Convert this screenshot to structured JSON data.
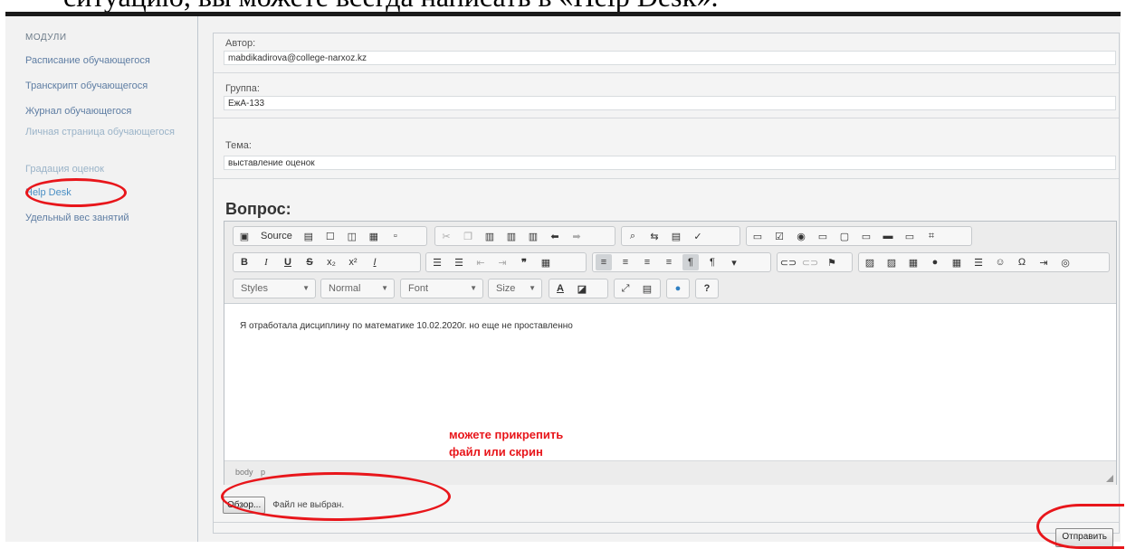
{
  "document": {
    "heading_fragment": "ситуацию, вы можете всегда написать в «Help Desk»."
  },
  "sidebar": {
    "header": "МОДУЛИ",
    "items": [
      {
        "label": "Расписание обучающегося"
      },
      {
        "label": "Транскрипт обучающегося"
      },
      {
        "label": "Журнал обучающегося"
      },
      {
        "label": "Личная страница обучающегося"
      },
      {
        "label": "Градация оценок"
      },
      {
        "label": "Help Desk"
      },
      {
        "label": "Удельный вес занятий"
      }
    ]
  },
  "form": {
    "author_label": "Автор:",
    "author_value": "mabdikadirova@college-narxoz.kz",
    "group_label": "Группа:",
    "group_value": "ЕжА-133",
    "subject_label": "Тема:",
    "subject_value": "выставление оценок",
    "question_label": "Вопрос:"
  },
  "editor": {
    "source_label": "Source",
    "styles_label": "Styles",
    "format_label": "Normal",
    "font_label": "Font",
    "size_label": "Size",
    "content": "Я отработала дисциплину по математике 10.02.2020г. но еще не проставленно",
    "path_body": "body",
    "path_p": "p"
  },
  "annotation": {
    "line1": "можете прикрепить",
    "line2": "файл или скрин",
    "color": "#e8161b"
  },
  "upload": {
    "browse_label": "Обзор...",
    "status": "Файл не выбран."
  },
  "submit": {
    "label": "Отправить"
  },
  "colors": {
    "link": "#4a8fc4",
    "highlight": "#e8161b",
    "panel_bg": "#f2f2f2"
  }
}
